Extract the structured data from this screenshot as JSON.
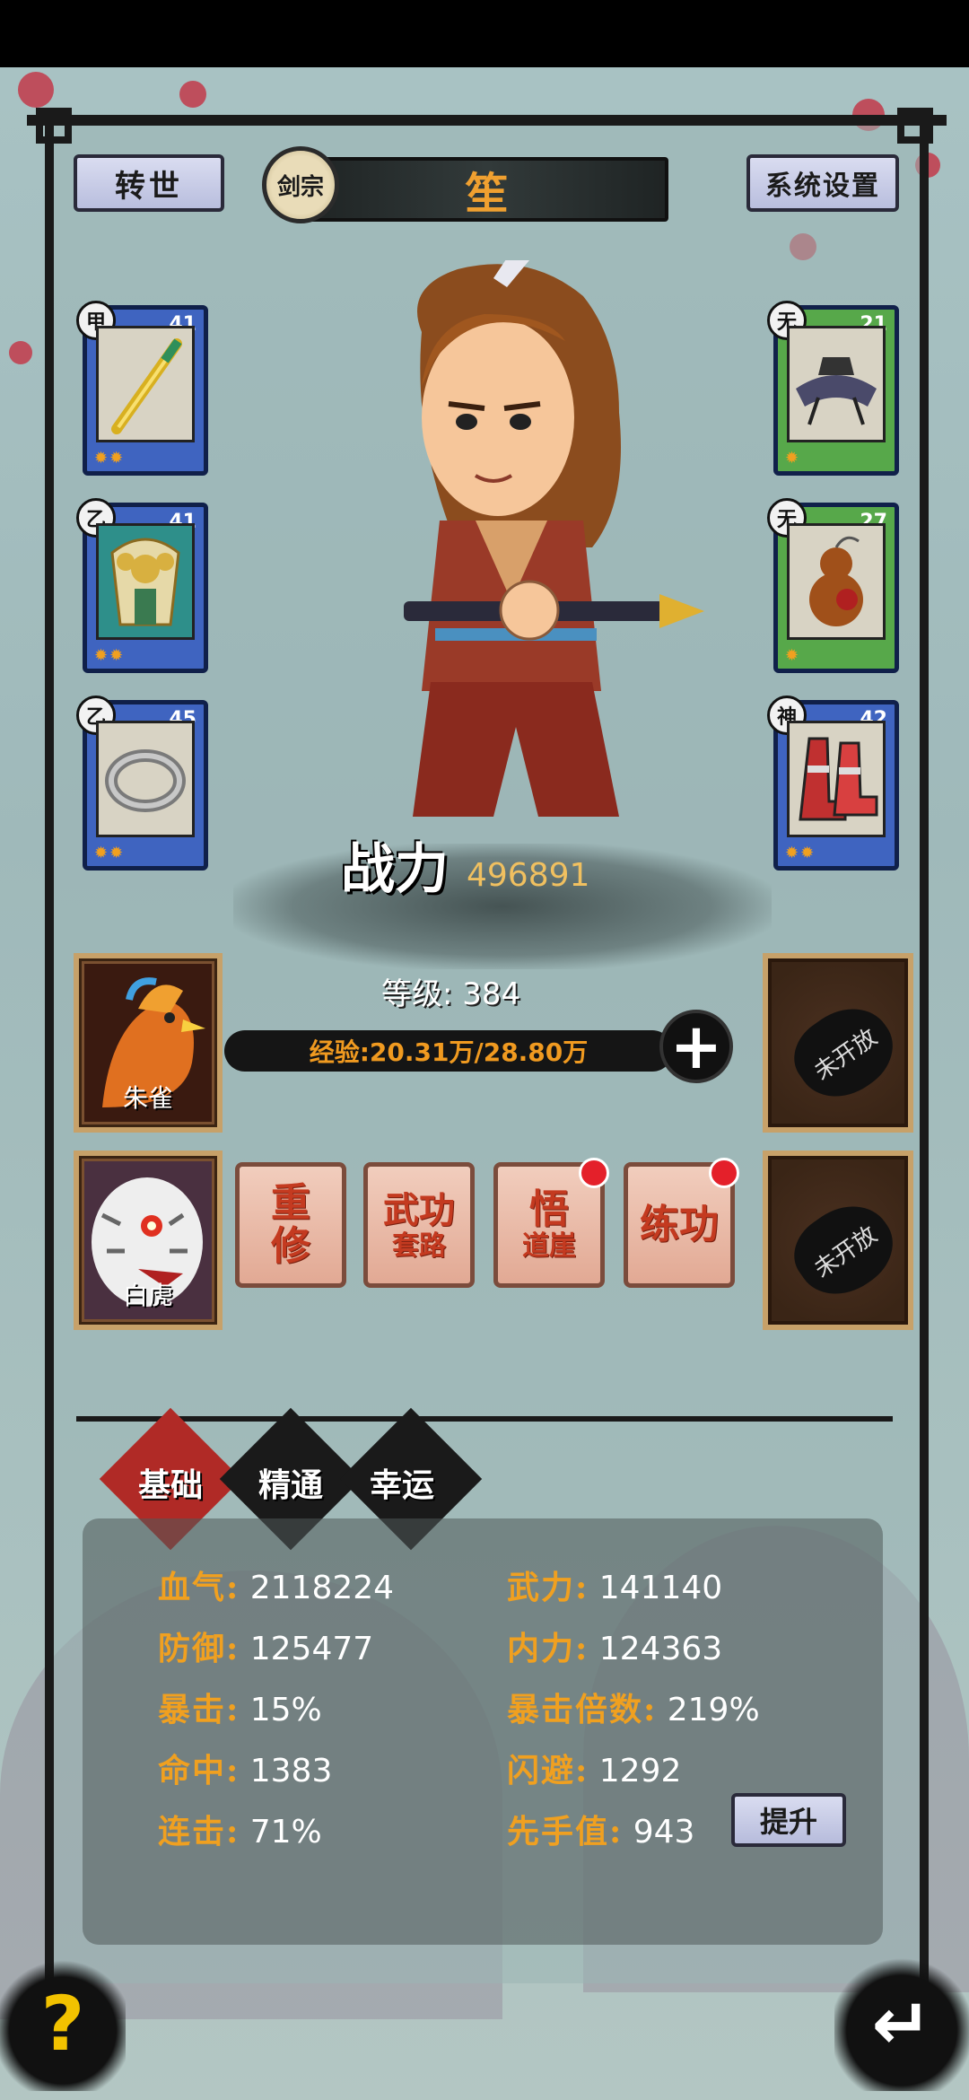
{
  "header": {
    "rebirth_label": "转世",
    "sect_label": "剑宗",
    "character_name": "笙",
    "settings_label": "系统设置"
  },
  "equipment_left": [
    {
      "grade": "甲",
      "level": "41",
      "item": "sword",
      "stars": "✹✹"
    },
    {
      "grade": "乙",
      "level": "41",
      "item": "armor",
      "stars": "✹✹"
    },
    {
      "grade": "乙",
      "level": "45",
      "item": "ring",
      "stars": "✹✹"
    }
  ],
  "equipment_right": [
    {
      "grade": "无",
      "level": "21",
      "item": "hat",
      "stars": "✹"
    },
    {
      "grade": "无",
      "level": "27",
      "item": "gourd",
      "stars": "✹"
    },
    {
      "grade": "神",
      "level": "42",
      "item": "boots",
      "stars": "✹✹"
    }
  ],
  "power": {
    "label": "战力",
    "value": "496891"
  },
  "level": {
    "text": "等级: 384"
  },
  "exp": {
    "text": "经验:20.31万/28.80万"
  },
  "beasts": [
    {
      "name": "朱雀"
    },
    {
      "name": "白虎"
    }
  ],
  "locked_label": "未开放",
  "actions": [
    {
      "line1": "重",
      "line2": "修",
      "badge": false
    },
    {
      "line1": "武功",
      "line2": "套路",
      "badge": false
    },
    {
      "line1": "悟",
      "line2": "道崖",
      "badge": true
    },
    {
      "line1": "练",
      "line2": "功",
      "badge": true
    }
  ],
  "tabs": [
    "基础",
    "精通",
    "幸运"
  ],
  "stats": {
    "hp": {
      "k": "血气:",
      "v": "2118224"
    },
    "atk": {
      "k": "武力:",
      "v": "141140"
    },
    "def": {
      "k": "防御:",
      "v": "125477"
    },
    "inner": {
      "k": "内力:",
      "v": "124363"
    },
    "crit": {
      "k": "暴击:",
      "v": "15%"
    },
    "critmul": {
      "k": "暴击倍数:",
      "v": "219%"
    },
    "hit": {
      "k": "命中:",
      "v": "1383"
    },
    "dodge": {
      "k": "闪避:",
      "v": "1292"
    },
    "combo": {
      "k": "连击:",
      "v": "71%"
    },
    "initiative": {
      "k": "先手值:",
      "v": "943"
    }
  },
  "upgrade_label": "提升",
  "help_icon": "?",
  "back_icon": "↵",
  "colors": {
    "accent": "#f0a020",
    "active_tab": "#b02a26",
    "badge": "#e4202a"
  }
}
